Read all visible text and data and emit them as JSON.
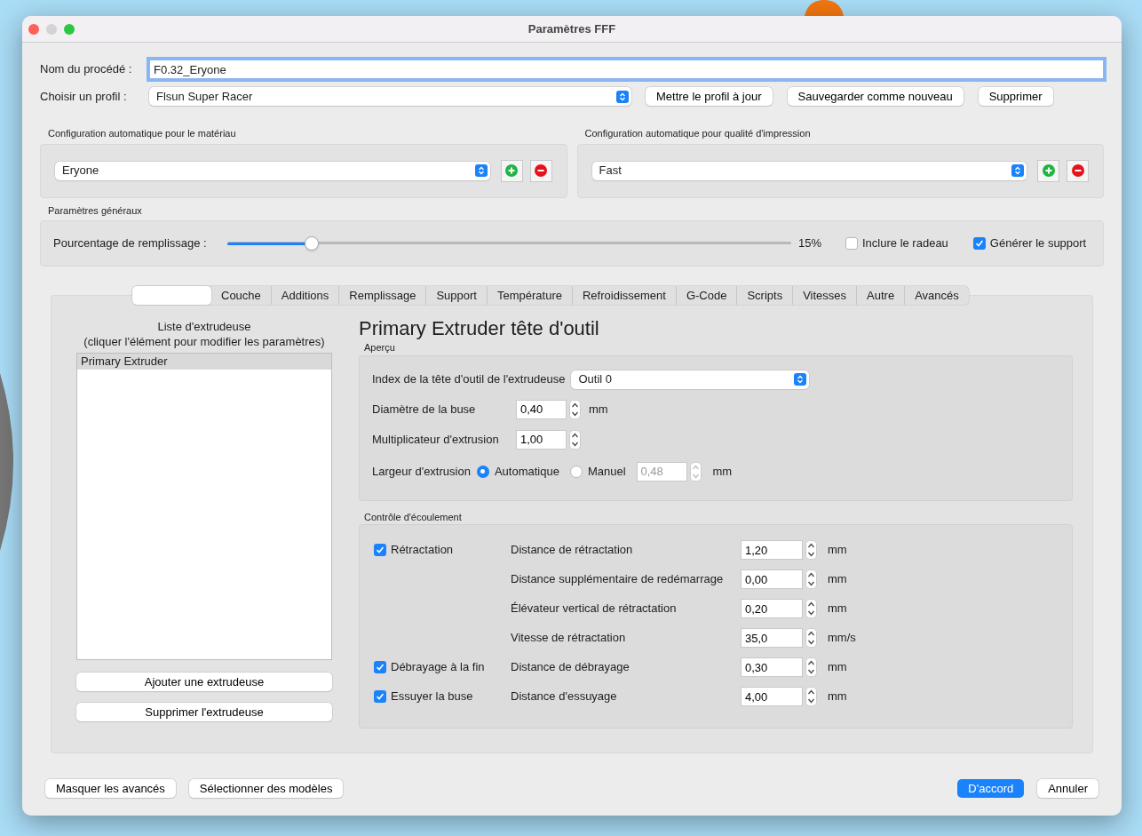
{
  "window": {
    "title": "Paramètres FFF"
  },
  "process_name": {
    "label": "Nom du procédé :",
    "value": "F0.32_Eryone"
  },
  "profile": {
    "label": "Choisir un profil :",
    "value": "Flsun Super Racer",
    "buttons": [
      "Mettre le profil à jour",
      "Sauvegarder comme nouveau",
      "Supprimer"
    ]
  },
  "auto_configs": [
    {
      "title": "Configuration automatique pour le matériau",
      "value": "Eryone"
    },
    {
      "title": "Configuration automatique pour qualité d'impression",
      "value": "Fast"
    }
  ],
  "general": {
    "title": "Paramètres généraux",
    "infill_label": "Pourcentage de remplissage :",
    "level": 0.15,
    "reading": "15%",
    "checkboxes": [
      {
        "label": "Inclure le radeau",
        "checked": false
      },
      {
        "label": "Générer le support",
        "checked": true
      }
    ]
  },
  "tabs": [
    {
      "selected": true
    },
    {
      "label": "Couche",
      "selected": false
    },
    {
      "label": "Additions",
      "selected": false
    },
    {
      "label": "Remplissage",
      "selected": false
    },
    {
      "label": "Support",
      "selected": false
    },
    {
      "label": "Température",
      "selected": false
    },
    {
      "label": "Refroidissement",
      "selected": false
    },
    {
      "label": "G-Code",
      "selected": false
    },
    {
      "label": "Scripts",
      "selected": false
    },
    {
      "label": "Vitesses",
      "selected": false
    },
    {
      "label": "Autre",
      "selected": false
    },
    {
      "label": "Avancés",
      "selected": false
    }
  ],
  "extruder_list": {
    "title": "Liste d'extrudeuse\n(cliquer l'élément pour modifier les paramètres)",
    "items": [
      {
        "label": "Primary Extruder",
        "selected": true
      }
    ],
    "buttons": [
      "Ajouter une extrudeuse",
      "Supprimer l'extrudeuse"
    ]
  },
  "heading": "Primary Extruder tête d'outil",
  "overview": {
    "title": "Aperçu",
    "toolhead_label": "Index de la tête d'outil de l'extrudeuse",
    "toolhead_value": "Outil 0",
    "nozzle_label": "Diamètre de la buse",
    "nozzle_value": "0,40",
    "nozzle_unit": "mm",
    "multiplier_label": "Multiplicateur d'extrusion",
    "multiplier_value": "1,00",
    "width_label": "Largeur d'extrusion",
    "width_options": [
      {
        "label": "Automatique",
        "selected": true
      },
      {
        "label": "Manuel",
        "selected": false
      }
    ],
    "width_value": "0,48",
    "width_disabled": true,
    "width_unit": "mm"
  },
  "flow": {
    "title": "Contrôle d'écoulement",
    "rows": [
      {
        "checkbox": {
          "label": "Rétractation",
          "checked": true
        },
        "label": "Distance de rétractation",
        "value": "1,20",
        "unit": "mm"
      },
      {
        "label": "Distance supplémentaire de redémarrage",
        "value": "0,00",
        "unit": "mm"
      },
      {
        "label": "Élévateur vertical de rétractation",
        "value": "0,20",
        "unit": "mm"
      },
      {
        "label": "Vitesse de rétractation",
        "value": "35,0",
        "unit": "mm/s"
      },
      {
        "checkbox": {
          "label": "Débrayage à la fin",
          "checked": true
        },
        "label": "Distance de débrayage",
        "value": "0,30",
        "unit": "mm"
      },
      {
        "checkbox": {
          "label": "Essuyer la buse",
          "checked": true
        },
        "label": "Distance d'essuyage",
        "value": "4,00",
        "unit": "mm"
      }
    ]
  },
  "footer": {
    "left_buttons": [
      "Masquer les avancés",
      "Sélectionner des modèles"
    ],
    "ok": "D'accord",
    "cancel": "Annuler"
  }
}
